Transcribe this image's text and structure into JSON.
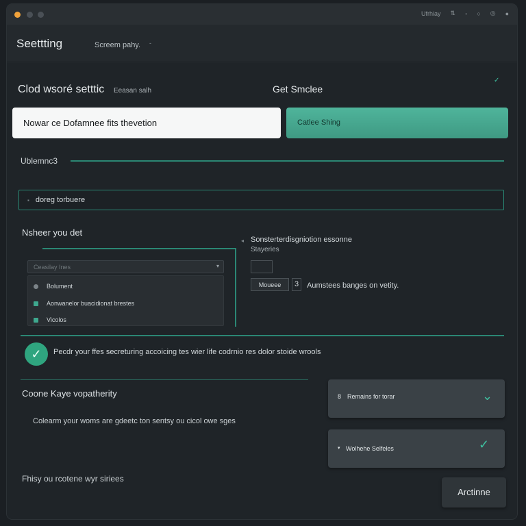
{
  "window": {
    "titlebar_right": [
      "Ufrhiay",
      "⇅",
      "◦"
    ],
    "app_title": "Seettting",
    "subtitle": "Screem pahy.",
    "subtitle_caret": "-"
  },
  "top": {
    "left_title": "Clod wsoré setttic",
    "left_note": "Eeasan salh",
    "right_title": "Get Smclee",
    "white_card": "Nowar ce Dofamnee fits thevetion",
    "green_card": "Catlee Shing"
  },
  "divider_label": "Ublemnc3",
  "search": {
    "icon": "search-icon",
    "value": "doreg torbuere"
  },
  "nav": {
    "label": "Nsheer you det",
    "select_placeholder": "Ceasilay Ines",
    "dropdown_items": [
      {
        "label": "Bolument",
        "marker": "grey"
      },
      {
        "label": "Aonwanelor buacidionat brestes",
        "marker": "green"
      },
      {
        "label": "Vicolos",
        "marker": "green"
      }
    ]
  },
  "right_panel": {
    "title": "Sonsterterdisgniotion essonne",
    "sub": "Stayeries",
    "mode_button": "Moueee",
    "mode_number": "3",
    "mode_desc": "Aumstees banges on vetity."
  },
  "confirm": {
    "text": "Pecdr your ffes secreturing accoicing tes wier life codrnio res dolor stoide wrools"
  },
  "section2": {
    "title": "Coone Kaye vopatherity",
    "text": "Colearm your woms are gdeetc ton sentsy ou cicol owe sges",
    "bottom": "Fhisy ou rcotene wyr siriees"
  },
  "options": [
    {
      "label": "Remains for torar",
      "prefix": "8"
    },
    {
      "label": "Wolhehe Selfeles",
      "prefix": "▾"
    }
  ],
  "continue_label": "Arctinne",
  "colors": {
    "accent": "#3ea88e",
    "background": "#1f2428",
    "card_green": "#4fb49b"
  }
}
